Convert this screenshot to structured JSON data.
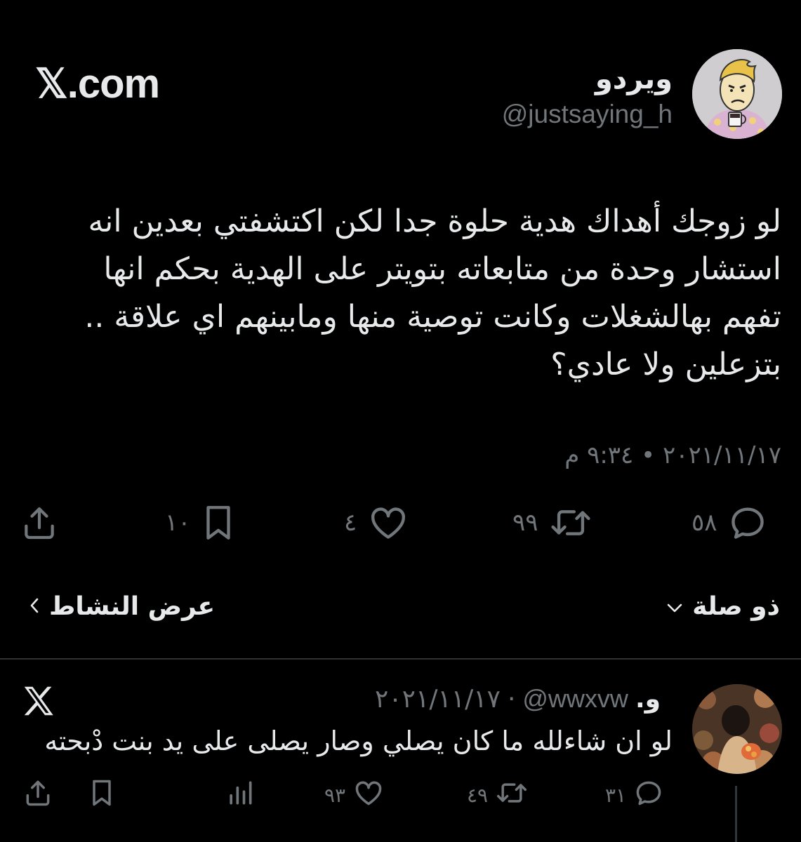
{
  "brand": "𝕏.com",
  "tweet": {
    "display_name": "ويردو",
    "handle": "@justsaying_h",
    "text_lines": [
      "لو زوجك أهداك هدية حلوة جدا لكن اكتشفتي بعدين انه",
      "استشار وحدة من متابعاته بتويتر على الهدية بحكم انها",
      "تفهم بهالشغلات وكانت توصية منها ومابينهم اي علاقة ..",
      "بتزعلين ولا عادي؟"
    ],
    "timestamp": "٢٠٢١/١١/١٧ • ٩:٣٤ م",
    "counts": {
      "replies": "٥٨",
      "retweets": "٩٩",
      "likes": "٤",
      "bookmarks": "١٠"
    },
    "thread_label": "ذو صلة",
    "activity_label": "عرض النشاط"
  },
  "reply": {
    "display_name": "و.",
    "handle": "@wwxvw",
    "date": "٢٠٢١/١١/١٧",
    "text": "لو ان شاءلله ما كان يصلي وصار يصلى على يد بنت دْبحته",
    "counts": {
      "replies": "٣١",
      "retweets": "٤٩",
      "likes": "٩٣"
    }
  },
  "icons": {
    "reply": "reply-icon",
    "retweet": "retweet-icon",
    "like": "heart-icon",
    "bookmark": "bookmark-icon",
    "share": "share-icon",
    "views": "views-icon",
    "x_logo": "x-logo-icon"
  },
  "colors": {
    "background": "#000000",
    "text": "#e7e9ea",
    "muted": "#71767b",
    "divider": "#2f3336"
  }
}
